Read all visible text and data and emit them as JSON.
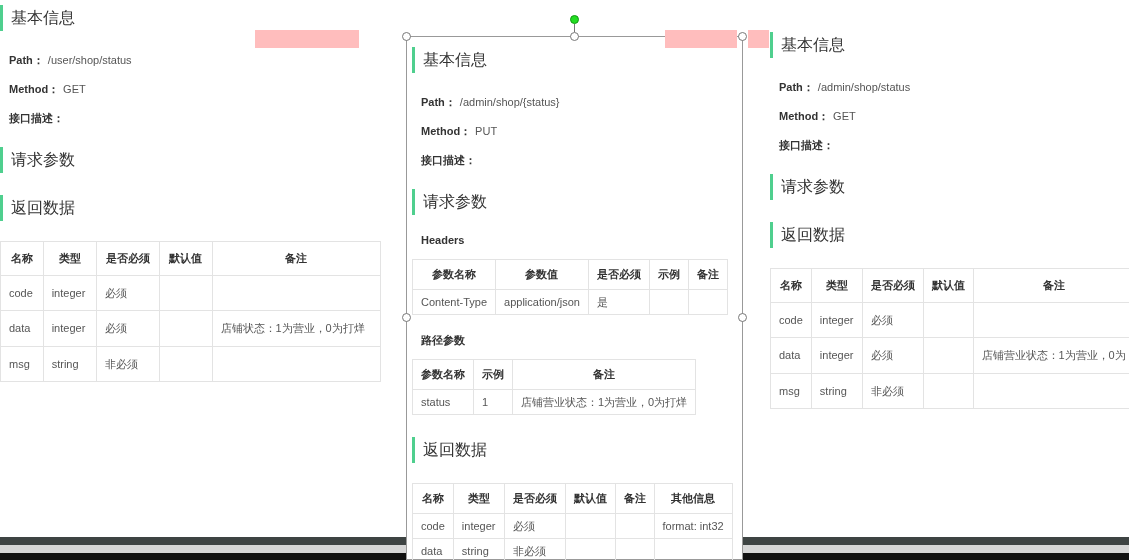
{
  "panels": [
    {
      "selected": false,
      "blocks": [
        {
          "kind": "heading",
          "text": "基本信息"
        },
        {
          "kind": "field",
          "label": "Path：",
          "value": "/user/shop/status"
        },
        {
          "kind": "field",
          "label": "Method：",
          "value": "GET"
        },
        {
          "kind": "field",
          "label": "接口描述："
        },
        {
          "kind": "heading",
          "text": "请求参数"
        },
        {
          "kind": "heading",
          "text": "返回数据"
        },
        {
          "kind": "table",
          "columns": [
            "名称",
            "类型",
            "是否必须",
            "默认值",
            "备注"
          ],
          "rows": [
            [
              "code",
              "integer",
              "必须",
              "",
              ""
            ],
            [
              "data",
              "integer",
              "必须",
              "",
              "店铺状态：1为营业，0为打烊"
            ],
            [
              "msg",
              "string",
              "非必须",
              "",
              ""
            ]
          ]
        }
      ]
    },
    {
      "selected": true,
      "blocks": [
        {
          "kind": "heading",
          "text": "基本信息"
        },
        {
          "kind": "field",
          "label": "Path：",
          "value": "/admin/shop/{status}"
        },
        {
          "kind": "field",
          "label": "Method：",
          "value": "PUT"
        },
        {
          "kind": "field",
          "label": "接口描述："
        },
        {
          "kind": "heading",
          "text": "请求参数"
        },
        {
          "kind": "subheading",
          "text": "Headers"
        },
        {
          "kind": "table",
          "columns": [
            "参数名称",
            "参数值",
            "是否必须",
            "示例",
            "备注"
          ],
          "rows": [
            [
              "Content-Type",
              "application/json",
              "是",
              "",
              ""
            ]
          ]
        },
        {
          "kind": "subheading",
          "text": "路径参数"
        },
        {
          "kind": "table",
          "columns": [
            "参数名称",
            "示例",
            "备注"
          ],
          "rows": [
            [
              "status",
              "1",
              "店铺营业状态：1为营业，0为打烊"
            ]
          ]
        },
        {
          "kind": "heading",
          "text": "返回数据"
        },
        {
          "kind": "table",
          "columns": [
            "名称",
            "类型",
            "是否必须",
            "默认值",
            "备注",
            "其他信息"
          ],
          "rows": [
            [
              "code",
              "integer",
              "必须",
              "",
              "",
              "format: int32"
            ],
            [
              "data",
              "string",
              "非必须",
              "",
              "",
              ""
            ]
          ]
        }
      ]
    },
    {
      "selected": false,
      "blocks": [
        {
          "kind": "heading",
          "text": "基本信息"
        },
        {
          "kind": "field",
          "label": "Path：",
          "value": "/admin/shop/status"
        },
        {
          "kind": "field",
          "label": "Method：",
          "value": "GET"
        },
        {
          "kind": "field",
          "label": "接口描述："
        },
        {
          "kind": "heading",
          "text": "请求参数"
        },
        {
          "kind": "heading",
          "text": "返回数据"
        },
        {
          "kind": "table",
          "columns": [
            "名称",
            "类型",
            "是否必须",
            "默认值",
            "备注"
          ],
          "rows": [
            [
              "code",
              "integer",
              "必须",
              "",
              ""
            ],
            [
              "data",
              "integer",
              "必须",
              "",
              "店铺营业状态：1为营业，0为"
            ],
            [
              "msg",
              "string",
              "非必须",
              "",
              ""
            ]
          ]
        }
      ]
    }
  ]
}
